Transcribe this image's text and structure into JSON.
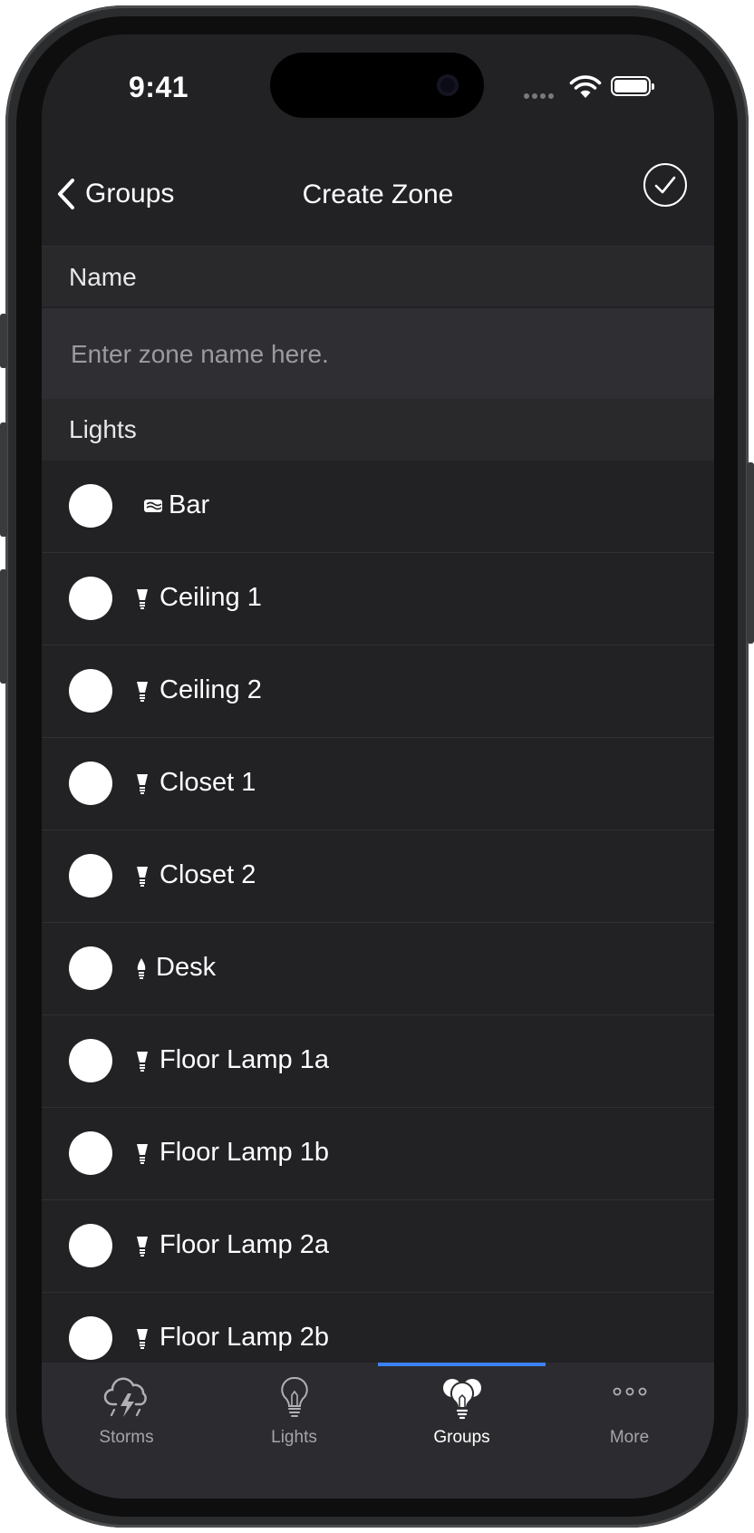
{
  "status": {
    "time": "9:41"
  },
  "nav": {
    "back_label": "Groups",
    "title": "Create Zone"
  },
  "name_section": {
    "header": "Name",
    "placeholder": "Enter zone name here.",
    "value": ""
  },
  "lights_section": {
    "header": "Lights",
    "items": [
      {
        "label": "Bar",
        "icon": "light-strip-icon",
        "selected": false
      },
      {
        "label": "Ceiling 1",
        "icon": "bulb-icon",
        "selected": false
      },
      {
        "label": "Ceiling 2",
        "icon": "bulb-icon",
        "selected": false
      },
      {
        "label": "Closet 1",
        "icon": "bulb-icon",
        "selected": false
      },
      {
        "label": "Closet 2",
        "icon": "bulb-icon",
        "selected": false
      },
      {
        "label": "Desk",
        "icon": "candle-bulb-icon",
        "selected": false
      },
      {
        "label": "Floor Lamp 1a",
        "icon": "bulb-icon",
        "selected": false
      },
      {
        "label": "Floor Lamp 1b",
        "icon": "bulb-icon",
        "selected": false
      },
      {
        "label": "Floor Lamp 2a",
        "icon": "bulb-icon",
        "selected": false
      },
      {
        "label": "Floor Lamp 2b",
        "icon": "bulb-icon",
        "selected": false
      }
    ]
  },
  "tabbar": {
    "active_tab": "Groups",
    "accent_color": "#3b82f6",
    "tabs": [
      {
        "label": "Storms",
        "icon": "storm-icon"
      },
      {
        "label": "Lights",
        "icon": "lightbulb-icon"
      },
      {
        "label": "Groups",
        "icon": "bulb-group-icon"
      },
      {
        "label": "More",
        "icon": "ellipsis-icon"
      }
    ]
  }
}
